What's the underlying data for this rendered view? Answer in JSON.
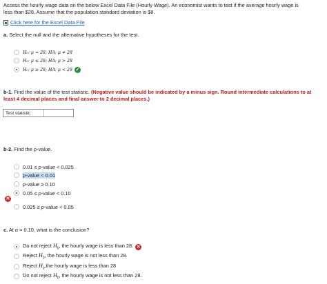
{
  "intro": {
    "line1": "Access the hourly wage data on the below Excel Data File (Hourly Wage). An economist wants to test if the average hourly wage is",
    "line2": "less than $28. Assume that the population standard deviation is $8."
  },
  "link": {
    "label": "Click here for the Excel Data File"
  },
  "part_a": {
    "heading_prefix": "a.",
    "heading_text": " Select the null and the alternative hypotheses for the test.",
    "options": [
      "H₀: μ = 28; HA: μ ≠ 28",
      "H₀: μ ≤ 28; HA: μ > 28",
      "H₀: μ ≥ 28; HA: μ < 28"
    ],
    "selected_index": 2,
    "correct_mark": "✓"
  },
  "part_b1": {
    "heading_prefix": "b-1.",
    "heading_text": " Find the value of the test statistic. ",
    "heading_red_line1": "(Negative value should be indicated by a minus sign. Round intermediate calculations to at",
    "heading_red_line2": "least 4 decimal places and final answer to 2 decimal places.)",
    "field_label": "Test statistic",
    "field_value": ""
  },
  "part_b2": {
    "heading_prefix": "b-2.",
    "heading_text": " Find the ",
    "heading_italic": "p",
    "heading_tail": "-value.",
    "options": [
      {
        "pre": "0.01 ≤ ",
        "p": "p",
        "post": "-value < 0.025"
      },
      {
        "pre": "",
        "p": "p",
        "post": "-value < 0.01"
      },
      {
        "pre": "",
        "p": "p",
        "post": "-value ≥ 0.10"
      },
      {
        "pre": "0.05 ≤ ",
        "p": "p",
        "post": "-value < 0.10"
      },
      {
        "pre": "0.025 ≤ ",
        "p": "p",
        "post": "-value < 0.05"
      }
    ],
    "selected_index": 3,
    "wrong_mark": "✕"
  },
  "part_c": {
    "heading_prefix": "c.",
    "heading_pre": " At ",
    "heading_alpha": "α",
    "heading_post": " = 0.10, what is the conclusion?",
    "options": [
      {
        "pre": "Do not reject ",
        "H": "H",
        "sub": "0",
        "post": ", the hourly wage is less than 28."
      },
      {
        "pre": "Reject ",
        "H": "H",
        "sub": "0",
        "post": ", the hourly wage is not less than 28."
      },
      {
        "pre": "Reject ",
        "H": "H",
        "sub": "0",
        "post": ",the hourly wage is less than 28"
      },
      {
        "pre": "Do not reject ",
        "H": "H",
        "sub": "0",
        "post": ", the hourly wage is not less than 28."
      }
    ],
    "selected_index": 0,
    "wrong_mark": "✕"
  }
}
